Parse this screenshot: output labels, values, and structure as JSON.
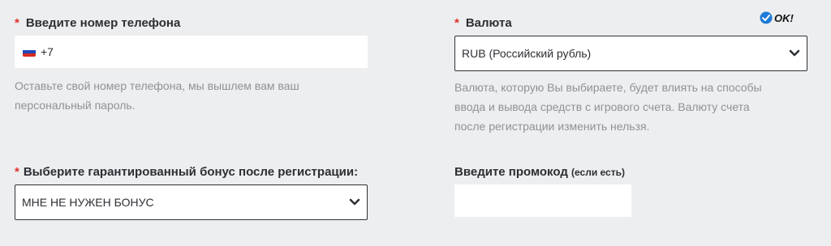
{
  "phone": {
    "required_mark": "*",
    "label": "Введите номер телефона",
    "flag_icon": "russia-flag-icon",
    "prefix": "+7",
    "help_line1": "Оставьте свой номер телефона, мы вышлем вам ваш",
    "help_line2": "персональный пароль."
  },
  "currency": {
    "required_mark": "*",
    "label": "Валюта",
    "ok_badge": "OK!",
    "ok_icon": "check-circle-icon",
    "selected": "RUB (Российский рубль)",
    "help_line1": "Валюта, которую Вы выбираете, будет влиять на способы",
    "help_line2": "ввода и вывода средств с игрового счета. Валюту счета",
    "help_line3": "после регистрации изменить нельзя."
  },
  "bonus": {
    "required_mark": "*",
    "label": "Выберите гарантированный бонус после регистрации:",
    "selected": "МНЕ НЕ НУЖЕН БОНУС"
  },
  "promo": {
    "label": "Введите промокод",
    "label_note": "(если есть)",
    "value": ""
  },
  "colors": {
    "background": "#eceeef",
    "required": "#e0312b",
    "help_text": "#8f9397",
    "ok_check": "#1e7ad6"
  }
}
